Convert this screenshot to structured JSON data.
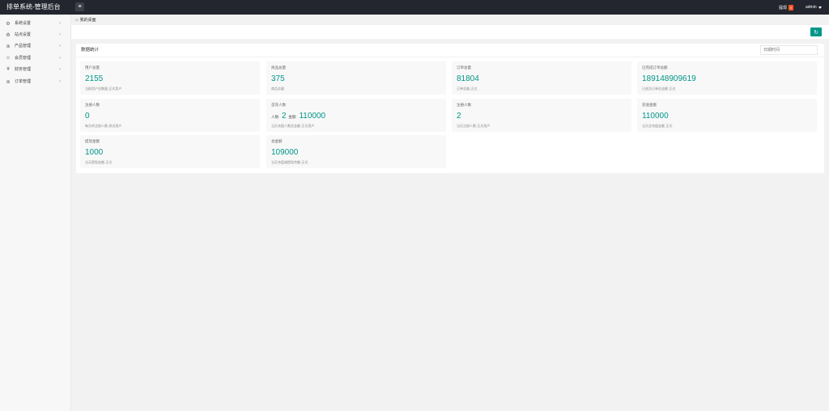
{
  "app": {
    "title": "排单系统-管理后台"
  },
  "topbar": {
    "notice_label": "提现",
    "notice_count": "0",
    "user_name": "admin"
  },
  "sidebar": {
    "items": [
      {
        "label": "系统设置",
        "icon": "gear-icon"
      },
      {
        "label": "站点设置",
        "icon": "cycle-icon"
      },
      {
        "label": "产品管理",
        "icon": "bag-icon"
      },
      {
        "label": "会员管理",
        "icon": "user-icon"
      },
      {
        "label": "财务管理",
        "icon": "money-icon"
      },
      {
        "label": "订单管理",
        "icon": "order-icon"
      }
    ]
  },
  "breadcrumb": {
    "home_label": "我的桌面"
  },
  "panel": {
    "title": "数据统计",
    "date_placeholder": "日期时间"
  },
  "cards": [
    {
      "title": "用户总量",
      "value": "2155",
      "note": "当前用户总数量-正式用户"
    },
    {
      "title": "商品总量",
      "value": "375",
      "note": "商品总量"
    },
    {
      "title": "订单总量",
      "value": "81804",
      "note": "订单总量-正式"
    },
    {
      "title": "已完成订单总额",
      "value": "189148909619",
      "note": "已成功订单总金额-正式"
    },
    {
      "title": "注册人数",
      "value": "0",
      "note": "每天的注册人数-测试用户"
    },
    {
      "title": "首充人数",
      "people_label": "人数:",
      "people_value": "2",
      "amount_label": "金额:",
      "amount_value": "110000",
      "note": "当天充值人数及金额-正式用户"
    },
    {
      "title": "注册人数",
      "value": "2",
      "note": "当天注册人数-正式用户"
    },
    {
      "title": "充值金额",
      "value": "110000",
      "note": "当天总充值金额-正式"
    },
    {
      "title": "提现金额",
      "value": "1000",
      "note": "当天提现金额-正式"
    },
    {
      "title": "总金额",
      "value": "109000",
      "note": "当天充值减提现余额-正式"
    }
  ],
  "colors": {
    "accent": "#009688",
    "topbar": "#23262e",
    "badge": "#ff5722"
  }
}
